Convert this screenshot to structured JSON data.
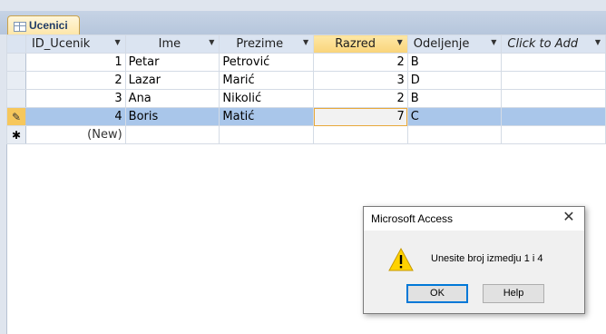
{
  "tab": {
    "label": "Ucenici"
  },
  "columns": [
    {
      "label": "ID_Ucenik"
    },
    {
      "label": "Ime"
    },
    {
      "label": "Prezime"
    },
    {
      "label": "Razred"
    },
    {
      "label": "Odeljenje"
    },
    {
      "label": "Click to Add"
    }
  ],
  "rows": [
    {
      "id": "1",
      "ime": "Petar",
      "prezime": "Petrović",
      "razred": "2",
      "odeljenje": "B"
    },
    {
      "id": "2",
      "ime": "Lazar",
      "prezime": "Marić",
      "razred": "3",
      "odeljenje": "D"
    },
    {
      "id": "3",
      "ime": "Ana",
      "prezime": "Nikolić",
      "razred": "2",
      "odeljenje": "B"
    },
    {
      "id": "4",
      "ime": "Boris",
      "prezime": "Matić",
      "razred": "7",
      "odeljenje": "C"
    }
  ],
  "new_row": {
    "label": "(New)"
  },
  "dialog": {
    "title": "Microsoft Access",
    "message": "Unesite broj izmedju 1 i 4",
    "ok_label": "OK",
    "help_label": "Help",
    "icon": "warning-icon"
  },
  "record_selectors": {
    "editing_glyph": "✎",
    "new_glyph": "✱"
  }
}
